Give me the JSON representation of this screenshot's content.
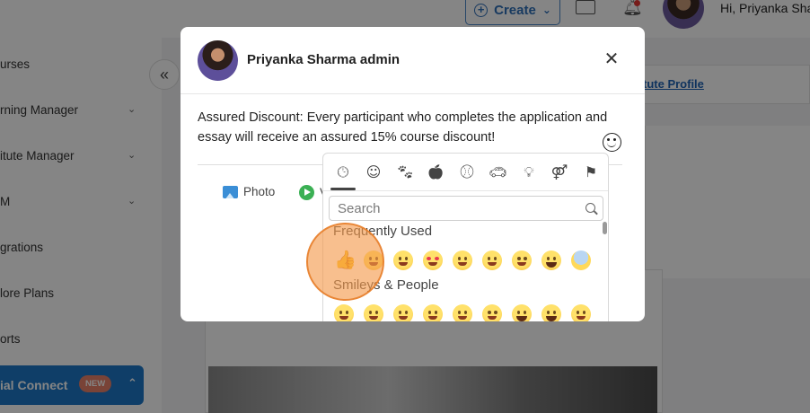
{
  "topbar": {
    "create_label": "Create",
    "greeting": "Hi, Priyanka Sha"
  },
  "sidebar": {
    "items": [
      {
        "label": "urses"
      },
      {
        "label": "rning Manager"
      },
      {
        "label": "itute Manager"
      },
      {
        "label": "M"
      },
      {
        "label": "grations"
      },
      {
        "label": "lore Plans"
      },
      {
        "label": "orts"
      }
    ],
    "social_label": "ial Connect",
    "new_badge": "NEW"
  },
  "content": {
    "profile_link": "tute Profile"
  },
  "modal": {
    "author": "Priyanka Sharma admin",
    "post_text": "Assured Discount: Every participant who completes the application and essay will receive an assured 15% course discount!",
    "photo_label": "Photo",
    "video_label": "V"
  },
  "picker": {
    "categories": [
      "recent-icon",
      "smileys-icon",
      "animals-icon",
      "food-icon",
      "activity-icon",
      "travel-icon",
      "objects-icon",
      "symbols-icon",
      "flags-icon"
    ],
    "search_placeholder": "Search",
    "frequently_used_title": "Frequently Used",
    "smileys_title": "Smileys & People",
    "frequently_used": [
      "thumbs-up",
      "grinning-squint",
      "kissing-wink",
      "heart-eyes",
      "laughing",
      "zany",
      "sweat-smile",
      "tears-of-joy",
      "scream"
    ],
    "smileys": [
      "grinning",
      "smiley",
      "smile",
      "grin",
      "laughing",
      "sweat-smile",
      "rofl",
      "tears-of-joy",
      "slight-smile"
    ]
  },
  "colors": {
    "accent": "#1e78c8",
    "highlight": "#f49848",
    "new_badge": "#e8806a"
  }
}
